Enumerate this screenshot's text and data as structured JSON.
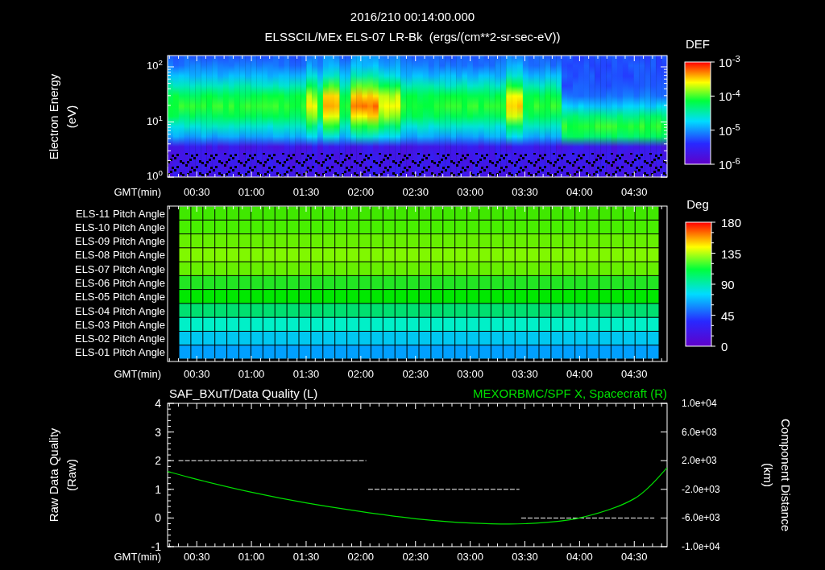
{
  "header": {
    "timestamp": "2016/210 00:14:00.000",
    "title": "ELSSCIL/MEx ELS-07 LR-Bk  (ergs/(cm**2-sr-sec-eV))"
  },
  "spectrogram": {
    "ylabel": [
      "Electron Energy",
      "(eV)"
    ],
    "yticks": [
      "10$^{2}$",
      "10$^{1}$",
      "10$^{0}$"
    ],
    "xaxis_label": "GMT(min)",
    "xticks": [
      "00:30",
      "01:00",
      "01:30",
      "02:00",
      "02:30",
      "03:00",
      "03:30",
      "04:00",
      "04:30"
    ],
    "colorbar": {
      "title": "DEF",
      "ticks": [
        "10$^{-3}$",
        "10$^{-4}$",
        "10$^{-5}$",
        "10$^{-6}$"
      ]
    }
  },
  "pitch_angle": {
    "rows": [
      {
        "label": "ELS-11 Pitch Angle",
        "color": "#40e800"
      },
      {
        "label": "ELS-10 Pitch Angle",
        "color": "#48f000"
      },
      {
        "label": "ELS-09 Pitch Angle",
        "color": "#66f000"
      },
      {
        "label": "ELS-08 Pitch Angle",
        "color": "#80f800"
      },
      {
        "label": "ELS-07 Pitch Angle",
        "color": "#66f000"
      },
      {
        "label": "ELS-06 Pitch Angle",
        "color": "#22e622"
      },
      {
        "label": "ELS-05 Pitch Angle",
        "color": "#00e800"
      },
      {
        "label": "ELS-04 Pitch Angle",
        "color": "#00e070"
      },
      {
        "label": "ELS-03 Pitch Angle",
        "color": "#00f0c8"
      },
      {
        "label": "ELS-02 Pitch Angle",
        "color": "#00c8f0"
      },
      {
        "label": "ELS-01 Pitch Angle",
        "color": "#00a0ff"
      }
    ],
    "xaxis_label": "GMT(min)",
    "xticks": [
      "00:30",
      "01:00",
      "01:30",
      "02:00",
      "02:30",
      "03:00",
      "03:30",
      "04:00",
      "04:30"
    ],
    "colorbar": {
      "title": "Deg",
      "ticks": [
        "180",
        "135",
        "90",
        "45",
        "0"
      ]
    }
  },
  "quality": {
    "ylabel": [
      "Raw Data Quality",
      "(Raw)"
    ],
    "right_ylabel": [
      "Component Distance",
      "(km)"
    ],
    "xaxis_label": "GMT(min)",
    "left": {
      "chart_data": {
        "type": "line",
        "x": [
          20,
          123,
          124,
          207,
          208,
          281
        ],
        "series": [
          {
            "name": "SAF_BXuT/Data Quality (L)",
            "color": "#ffffff",
            "line_style": "dashed",
            "values": [
              2,
              2,
              1,
              1,
              0,
              0
            ]
          }
        ],
        "xlim": [
          14,
          288
        ],
        "ylim": [
          -1,
          4
        ],
        "yticks": [
          4,
          3,
          2,
          1,
          0,
          -1
        ],
        "xticks": [
          {
            "value": 30,
            "label": "00:30"
          },
          {
            "value": 60,
            "label": "01:00"
          },
          {
            "value": 90,
            "label": "01:30"
          },
          {
            "value": 120,
            "label": "02:00"
          },
          {
            "value": 150,
            "label": "02:30"
          },
          {
            "value": 180,
            "label": "03:00"
          },
          {
            "value": 210,
            "label": "03:30"
          },
          {
            "value": 240,
            "label": "04:00"
          },
          {
            "value": 270,
            "label": "04:30"
          }
        ]
      }
    },
    "right": {
      "chart_data": {
        "type": "line",
        "x": [
          14,
          30,
          60,
          90,
          120,
          150,
          180,
          210,
          240,
          270,
          288
        ],
        "series": [
          {
            "name": "MEXORBMC/SPF X, Spacecraft (R)",
            "color": "#00e000",
            "values": [
              500,
              -600,
              -2400,
              -3900,
              -5100,
              -6100,
              -6700,
              -6800,
              -6000,
              -3300,
              1000
            ]
          }
        ],
        "xlim": [
          14,
          288
        ],
        "ylim": [
          -10000,
          10000
        ],
        "yticks": [
          {
            "value": 10000,
            "label": "1.0e+04"
          },
          {
            "value": 6000,
            "label": "6.0e+03"
          },
          {
            "value": 2000,
            "label": "2.0e+03"
          },
          {
            "value": -2000,
            "label": "-2.0e+03"
          },
          {
            "value": -6000,
            "label": "-6.0e+03"
          },
          {
            "value": -10000,
            "label": "-1.0e+04"
          }
        ]
      }
    }
  }
}
